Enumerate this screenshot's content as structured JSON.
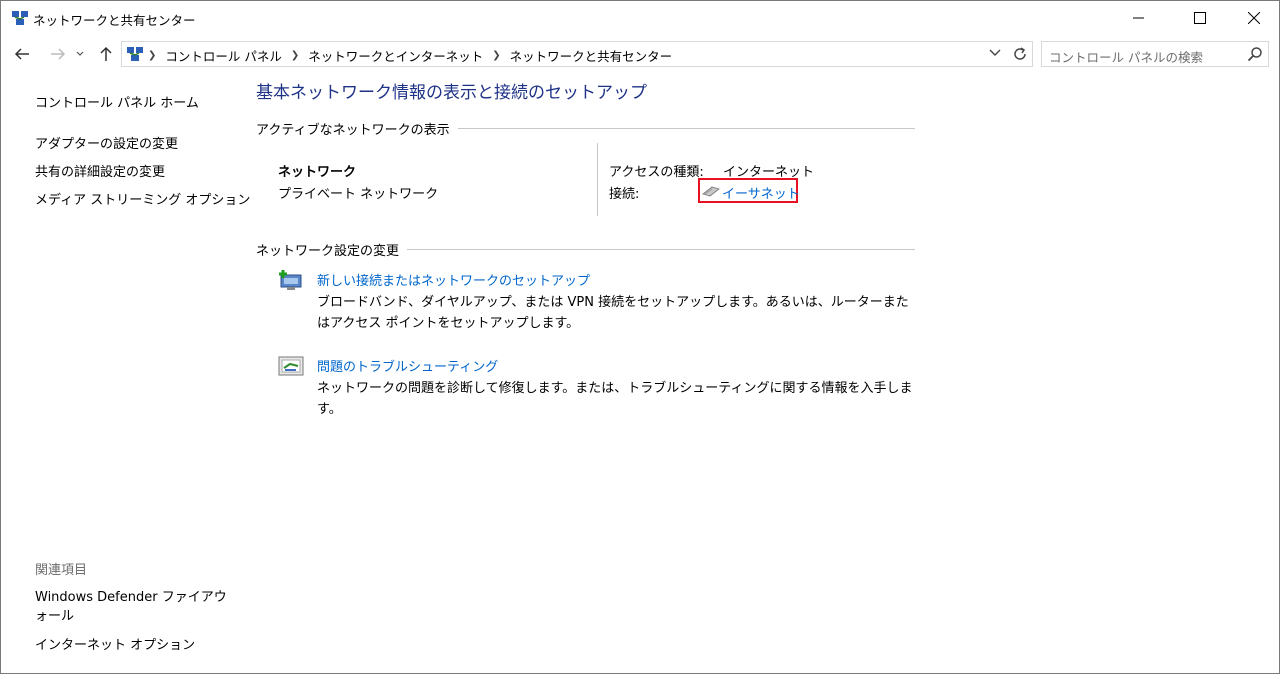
{
  "window": {
    "title": "ネットワークと共有センター"
  },
  "address": {
    "crumbs": [
      "コントロール パネル",
      "ネットワークとインターネット",
      "ネットワークと共有センター"
    ],
    "search_placeholder": "コントロール パネルの検索"
  },
  "sidebar": {
    "home": "コントロール パネル ホーム",
    "items": [
      "アダプターの設定の変更",
      "共有の詳細設定の変更",
      "メディア ストリーミング オプション"
    ],
    "related_heading": "関連項目",
    "related": [
      "Windows Defender ファイアウォール",
      "インターネット オプション"
    ]
  },
  "main": {
    "title": "基本ネットワーク情報の表示と接続のセットアップ",
    "active_heading": "アクティブなネットワークの表示",
    "network": {
      "name": "ネットワーク",
      "profile": "プライベート ネットワーク",
      "access_label": "アクセスの種類:",
      "access_value": "インターネット",
      "connection_label": "接続:",
      "connection_value": "イーサネット"
    },
    "change_heading": "ネットワーク設定の変更",
    "tasks": [
      {
        "icon": "new-connection-icon",
        "title": "新しい接続またはネットワークのセットアップ",
        "desc": "ブロードバンド、ダイヤルアップ、または VPN 接続をセットアップします。あるいは、ルーターまたはアクセス ポイントをセットアップします。"
      },
      {
        "icon": "troubleshoot-icon",
        "title": "問題のトラブルシューティング",
        "desc": "ネットワークの問題を診断して修復します。または、トラブルシューティングに関する情報を入手します。"
      }
    ]
  },
  "colors": {
    "title_blue": "#1e3287",
    "link_blue": "#0066cc",
    "highlight_red": "#e81123"
  }
}
